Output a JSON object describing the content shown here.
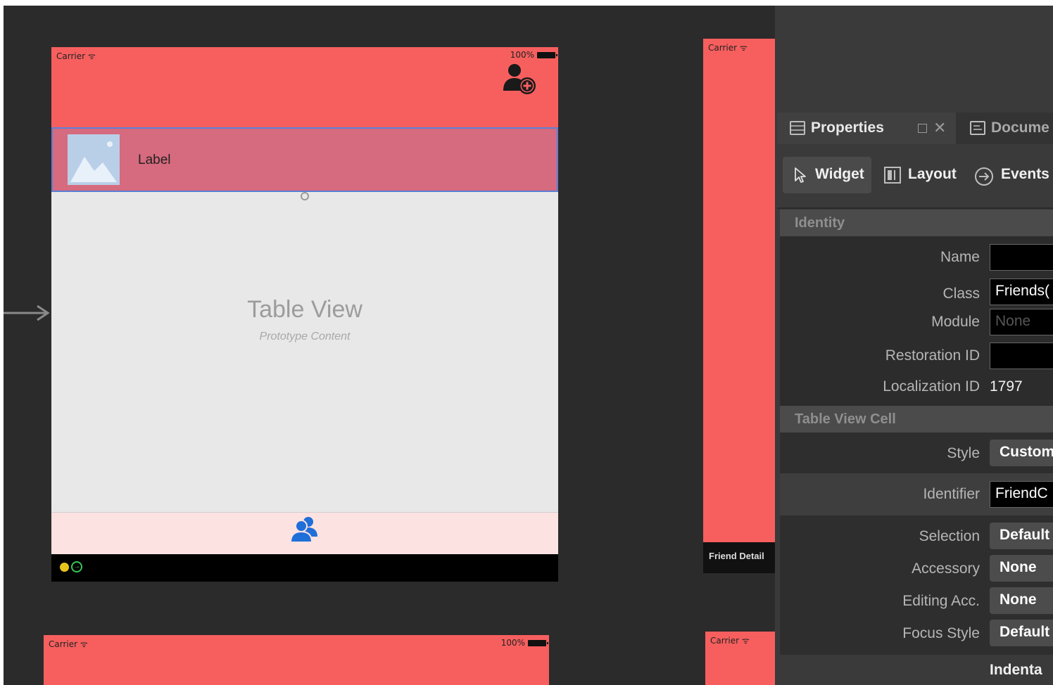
{
  "canvas": {
    "scene1": {
      "status_carrier": "Carrier ᯤ",
      "status_battery": "100%",
      "add_user_icon": "add-user-icon",
      "cell_label": "Label",
      "table_title": "Table View",
      "table_subtitle": "Prototype Content",
      "tab_icon": "friends-icon"
    },
    "scene2": {
      "status_carrier": "Carrier ᯤ",
      "caption": "Friend Detail"
    },
    "scene3": {
      "status_carrier": "Carrier ᯤ",
      "status_battery": "100%"
    },
    "scene4": {
      "status_carrier": "Carrier ᯤ"
    }
  },
  "properties_panel": {
    "tabs": [
      {
        "label": "Properties",
        "icon": "properties-icon"
      },
      {
        "label": "Docume",
        "icon": "document-icon"
      }
    ],
    "subtabs": [
      {
        "label": "Widget",
        "icon": "pointer-icon"
      },
      {
        "label": "Layout",
        "icon": "layout-icon"
      },
      {
        "label": "Events",
        "icon": "events-icon"
      }
    ],
    "identity": {
      "header": "Identity",
      "name_label": "Name",
      "name_value": "",
      "class_label": "Class",
      "class_value": "Friends(",
      "module_label": "Module",
      "module_placeholder": "None",
      "restoration_label": "Restoration ID",
      "restoration_value": "",
      "localization_label": "Localization ID",
      "localization_value": "1797"
    },
    "cell": {
      "header": "Table View Cell",
      "style_label": "Style",
      "style_value": "Custom",
      "identifier_label": "Identifier",
      "identifier_value": "FriendC",
      "selection_label": "Selection",
      "selection_value": "Default",
      "accessory_label": "Accessory",
      "accessory_value": "None",
      "editing_label": "Editing Acc.",
      "editing_value": "None",
      "focus_label": "Focus Style",
      "focus_value": "Default",
      "indentation_label": "Indenta"
    }
  }
}
